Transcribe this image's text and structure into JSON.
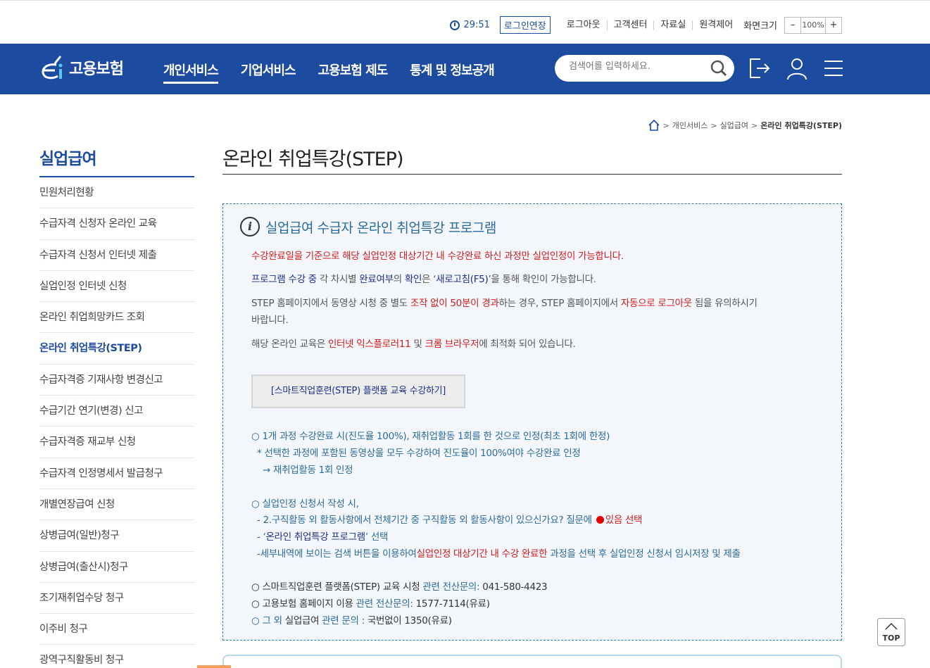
{
  "util": {
    "timer": "29:51",
    "extend": "로그인연장",
    "links": [
      "로그아웃",
      "고객센터",
      "자료실",
      "원격제어"
    ],
    "zoom_label": "화면크기",
    "zoom_minus": "–",
    "zoom_value": "100%",
    "zoom_plus": "+"
  },
  "header": {
    "logo_text": "고용보험",
    "nav": [
      "개인서비스",
      "기업서비스",
      "고용보험 제도",
      "통계 및 정보공개"
    ],
    "search_placeholder": "검색어를 입력하세요."
  },
  "breadcrumb": [
    "개인서비스",
    "실업급여",
    "온라인 취업특강(STEP)"
  ],
  "sidebar": {
    "title": "실업급여",
    "items": [
      "민원처리현황",
      "수급자격 신청자 온라인 교육",
      "수급자격 신청서 인터넷 제출",
      "실업인정 인터넷 신청",
      "온라인 취업희망카드 조회",
      "온라인 취업특강(STEP)",
      "수급자격증 기재사항 변경신고",
      "수급기간 연기(변경) 신고",
      "수급자격증 재교부 신청",
      "수급자격 인정명세서 발급청구",
      "개별연장급여 신청",
      "상병급여(일반)청구",
      "상병급여(출산시)청구",
      "조기재취업수당 청구",
      "이주비 청구",
      "광역구직활동비 청구"
    ],
    "active_index": 5
  },
  "main": {
    "title": "온라인 취업특강(STEP)",
    "info_icon": "i",
    "info_title": "실업급여 수급자 온라인 취업특강 프로그램",
    "p1": "수강완료일을 기준으로 해당 실업인정 대상기간 내 수강완료 하신 과정만 실업인정이 가능합니다.",
    "p2": {
      "a": "프로그램 수강 중",
      "b": " 각 차시별 ",
      "c": "완료여부",
      "d": "의 ",
      "e": "확인",
      "f": "은 ‘",
      "g": "새로고침(F5)",
      "h": "’을 통해 확인이 가능합니다."
    },
    "p3": {
      "a": "STEP 홈페이지에서 동영상 시청 중 별도 ",
      "b": "조작 없이 50분이 경과",
      "c": "하는 경우, STEP 홈페이지에서 ",
      "d": "자동으로 로그아웃",
      "e": " 됨을 유의하시기",
      "f": "바랍니다."
    },
    "p4": {
      "a": "해당 온라인 교육은 ",
      "b": "인터넷 익스플로러11",
      "c": " 및 ",
      "d": "크롬 브라우저",
      "e": "에 최적화 되어 있습니다."
    },
    "step_button": "[스마트직업훈련(STEP) 플랫폼 교육 수강하기]",
    "b1": {
      "l1": "○ 1개 과정 수강완료 시(진도율 100%), 재취업활동 1회를 한 것으로 인정(최초 1회에 한정)",
      "l2": "* 선택한 과정에 포함된 동영상을 모두 수강하여 진도율이 100%여야 수강완료 인정",
      "l3": "→ 재취업활동 1회 인정"
    },
    "b2": {
      "l1": "○ 실업인정 신청서 작성 시,",
      "l2a": "- 2.구직활동 외 활동사항에서 전체기간 중 구직활동 외 활동사항이 있으신가요? 질문에 ",
      "l2b": "있음 선택",
      "l3a": "- ‘",
      "l3b": "온라인 취업특강 프로그램",
      "l3c": "’ 선택",
      "l4a": "-세부내역에 보이는 검색 버튼을 이용하여",
      "l4b": "실업인정 대상기간 내 수강 완료한",
      "l4c": " 과정을 선택 후 실업인정 신청서 임시저장 및 제출"
    },
    "contacts": [
      {
        "a": "○ 스마트직업훈련 플랫폼(STEP) 교육 시청 ",
        "b": "관련 전산문의: ",
        "c": "041-580-4423"
      },
      {
        "a": "○ 고용보험 홈페이지 이용 ",
        "b": "관련 전산문의: ",
        "c": "1577-7114(유료)"
      },
      {
        "a": "○ 그 외 ",
        "a2": "실업급여",
        "b": " 관련 문의 : ",
        "c": "국번없이 1350(유료)"
      }
    ],
    "top_label": "TOP"
  }
}
